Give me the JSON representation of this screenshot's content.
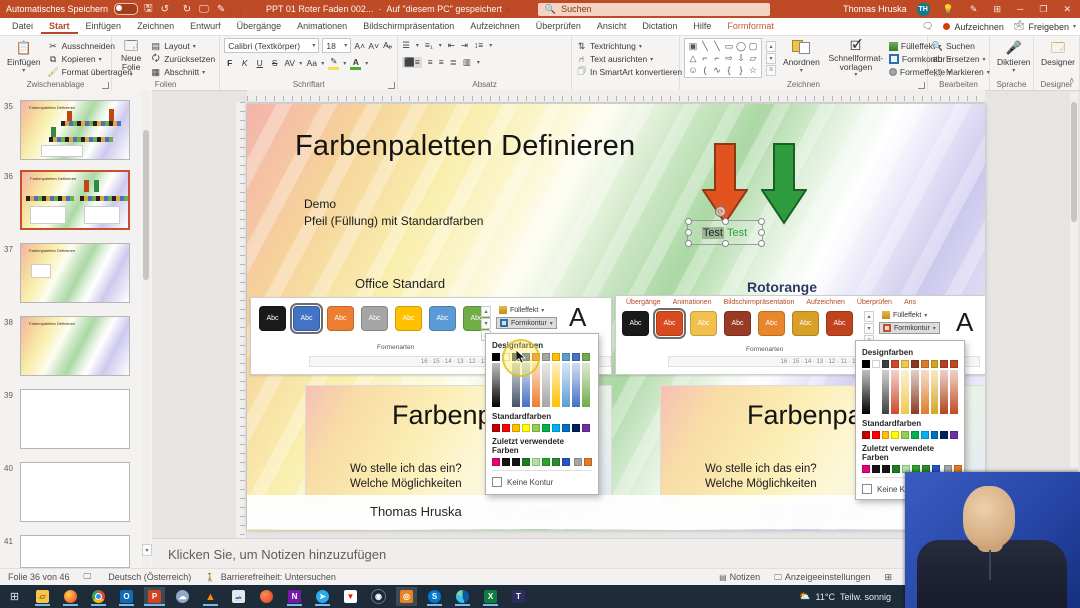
{
  "titlebar": {
    "autosave_label": "Automatisches Speichern",
    "doc_title": "PPT 01 Roter Faden 002...",
    "saved_status": "Auf \"diesem PC\" gespeichert",
    "search_placeholder": "Suchen",
    "user_name": "Thomas Hruska",
    "user_initials": "TH"
  },
  "tabs": {
    "items": [
      "Datei",
      "Start",
      "Einfügen",
      "Zeichnen",
      "Entwurf",
      "Übergänge",
      "Animationen",
      "Bildschirmpräsentation",
      "Aufzeichnen",
      "Überprüfen",
      "Ansicht",
      "Dictation",
      "Hilfe",
      "Formformat"
    ],
    "record_label": "Aufzeichnen",
    "share_label": "Freigeben"
  },
  "ribbon": {
    "paste_label": "Einfügen",
    "cut_label": "Ausschneiden",
    "copy_label": "Kopieren",
    "format_painter_label": "Format übertragen",
    "clipboard_group": "Zwischenablage",
    "new_slide_label": "Neue Folie",
    "layout_label": "Layout",
    "reset_label": "Zurücksetzen",
    "section_label": "Abschnitt",
    "slides_group": "Folien",
    "font_name": "Calibri (Textkörper)",
    "font_size": "18",
    "bold": "F",
    "italic": "K",
    "underline": "U",
    "strike": "S",
    "clear": "ab",
    "spacing": "AV",
    "case": "Aa",
    "font_group": "Schriftart",
    "text_direction_label": "Textrichtung",
    "align_text_label": "Text ausrichten",
    "smartart_label": "In SmartArt konvertieren",
    "paragraph_group": "Absatz",
    "arrange_label": "Anordnen",
    "quick_styles_label": "Schnellformat-vorlagen",
    "shape_fill_label": "Fülleffekt",
    "shape_outline_label": "Formkontur",
    "shape_effects_label": "Formeffekte",
    "drawing_group": "Zeichnen",
    "find_label": "Suchen",
    "replace_label": "Ersetzen",
    "select_label": "Markieren",
    "editing_group": "Bearbeiten",
    "dictate_label": "Diktieren",
    "language_group": "Sprache",
    "designer_label": "Designer",
    "designer_group": "Designer"
  },
  "slide_panel": {
    "slides": [
      "35",
      "36",
      "37",
      "38",
      "39",
      "40",
      "41"
    ],
    "current": "36"
  },
  "slide": {
    "title": "Farbenpaletten Definieren",
    "demo_line1": "Demo",
    "demo_line2": "Pfeil (Füllung) mit Standardfarben",
    "test1": "Test",
    "test2": "Test",
    "left_caption": "Office Standard",
    "right_caption": "Rotorange",
    "abc_label": "Abc",
    "formenarten_label": "Formenarten",
    "fill_label": "Fülleffekt",
    "outline_label": "Formkontur",
    "big_a": "A",
    "left_ruler": "16 · 15 · 14 · 13 · 12 · 11 · 10",
    "right_ruler": "16 · 15 · 14 · 13 · 12 · 11 · 10 · 9",
    "inner_tabs": [
      "Übergänge",
      "Animationen",
      "Bildschirmpräsentation",
      "Aufzeichnen",
      "Überprüfen",
      "Ans"
    ],
    "mini_title_left": "Farbenpale",
    "mini_title_right": "Farbenpal",
    "mini_line1": "Wo stelle ich das ein?",
    "mini_line2": "Welche Möglichkeiten",
    "author": "Thomas Hruska",
    "office_styles": [
      "#1a1a1a",
      "#4472c4",
      "#ed7d31",
      "#a5a5a5",
      "#ffc000",
      "#5b9bd5",
      "#70ad47"
    ],
    "office_selected": 1,
    "rotorange_styles": [
      "#1a1a1a",
      "#d84a1f",
      "#f2c14d",
      "#993a24",
      "#e8862b",
      "#d9a028",
      "#bf431c"
    ],
    "rotorange_selected": 1
  },
  "dropdown": {
    "design_label": "Designfarben",
    "standard_label": "Standardfarben",
    "recent_label": "Zuletzt verwendete Farben",
    "no_outline_label": "Keine Kontur",
    "office_theme": [
      "#000000",
      "#ffffff",
      "#44546a",
      "#4472c4",
      "#ed7d31",
      "#a5a5a5",
      "#ffc000",
      "#5b9bd5",
      "#4472c4",
      "#70ad47"
    ],
    "rotorange_theme": [
      "#000000",
      "#ffffff",
      "#3f3f3f",
      "#d1492a",
      "#f2c84c",
      "#8c3a20",
      "#e07b28",
      "#d9a521",
      "#b5431f",
      "#c24a22"
    ],
    "standard_colors": [
      "#c00000",
      "#ff0000",
      "#ffc000",
      "#ffff00",
      "#92d050",
      "#00b050",
      "#00b0f0",
      "#0070c0",
      "#002060",
      "#7030a0"
    ],
    "recent_colors": [
      "#e6007e",
      "#141414",
      "#141414",
      "#217a21",
      "#aee3a5",
      "#28a428",
      "#2a8c2a",
      "#2255c4"
    ],
    "recent_extra": [
      "#a6a6a6",
      "#e07b28"
    ]
  },
  "notes": {
    "placeholder": "Klicken Sie, um Notizen hinzuzufügen"
  },
  "statusbar": {
    "slide_counter": "Folie 36 von 46",
    "language": "Deutsch (Österreich)",
    "accessibility": "Barrierefreiheit: Untersuchen",
    "notes_label": "Notizen",
    "display_label": "Anzeigeeinstellungen"
  },
  "taskbar": {
    "weather_temp": "11°C",
    "weather_desc": "Teilw. sonnig",
    "icons": [
      "windows-start",
      "file-explorer",
      "firefox",
      "chrome",
      "outlook",
      "powerpoint",
      "paint3d",
      "vlc",
      "photos",
      "sticky-notes",
      "onenote",
      "telegram",
      "acrobat",
      "steam",
      "screen-recorder",
      "skype",
      "edge",
      "excel",
      "teams"
    ]
  },
  "colors": {
    "titlebar": "#bf4b26",
    "accent": "#b7472a",
    "taskbar": "#1e2c3a",
    "arrow_orange": "#e2531f",
    "arrow_green": "#2d9b3e"
  }
}
